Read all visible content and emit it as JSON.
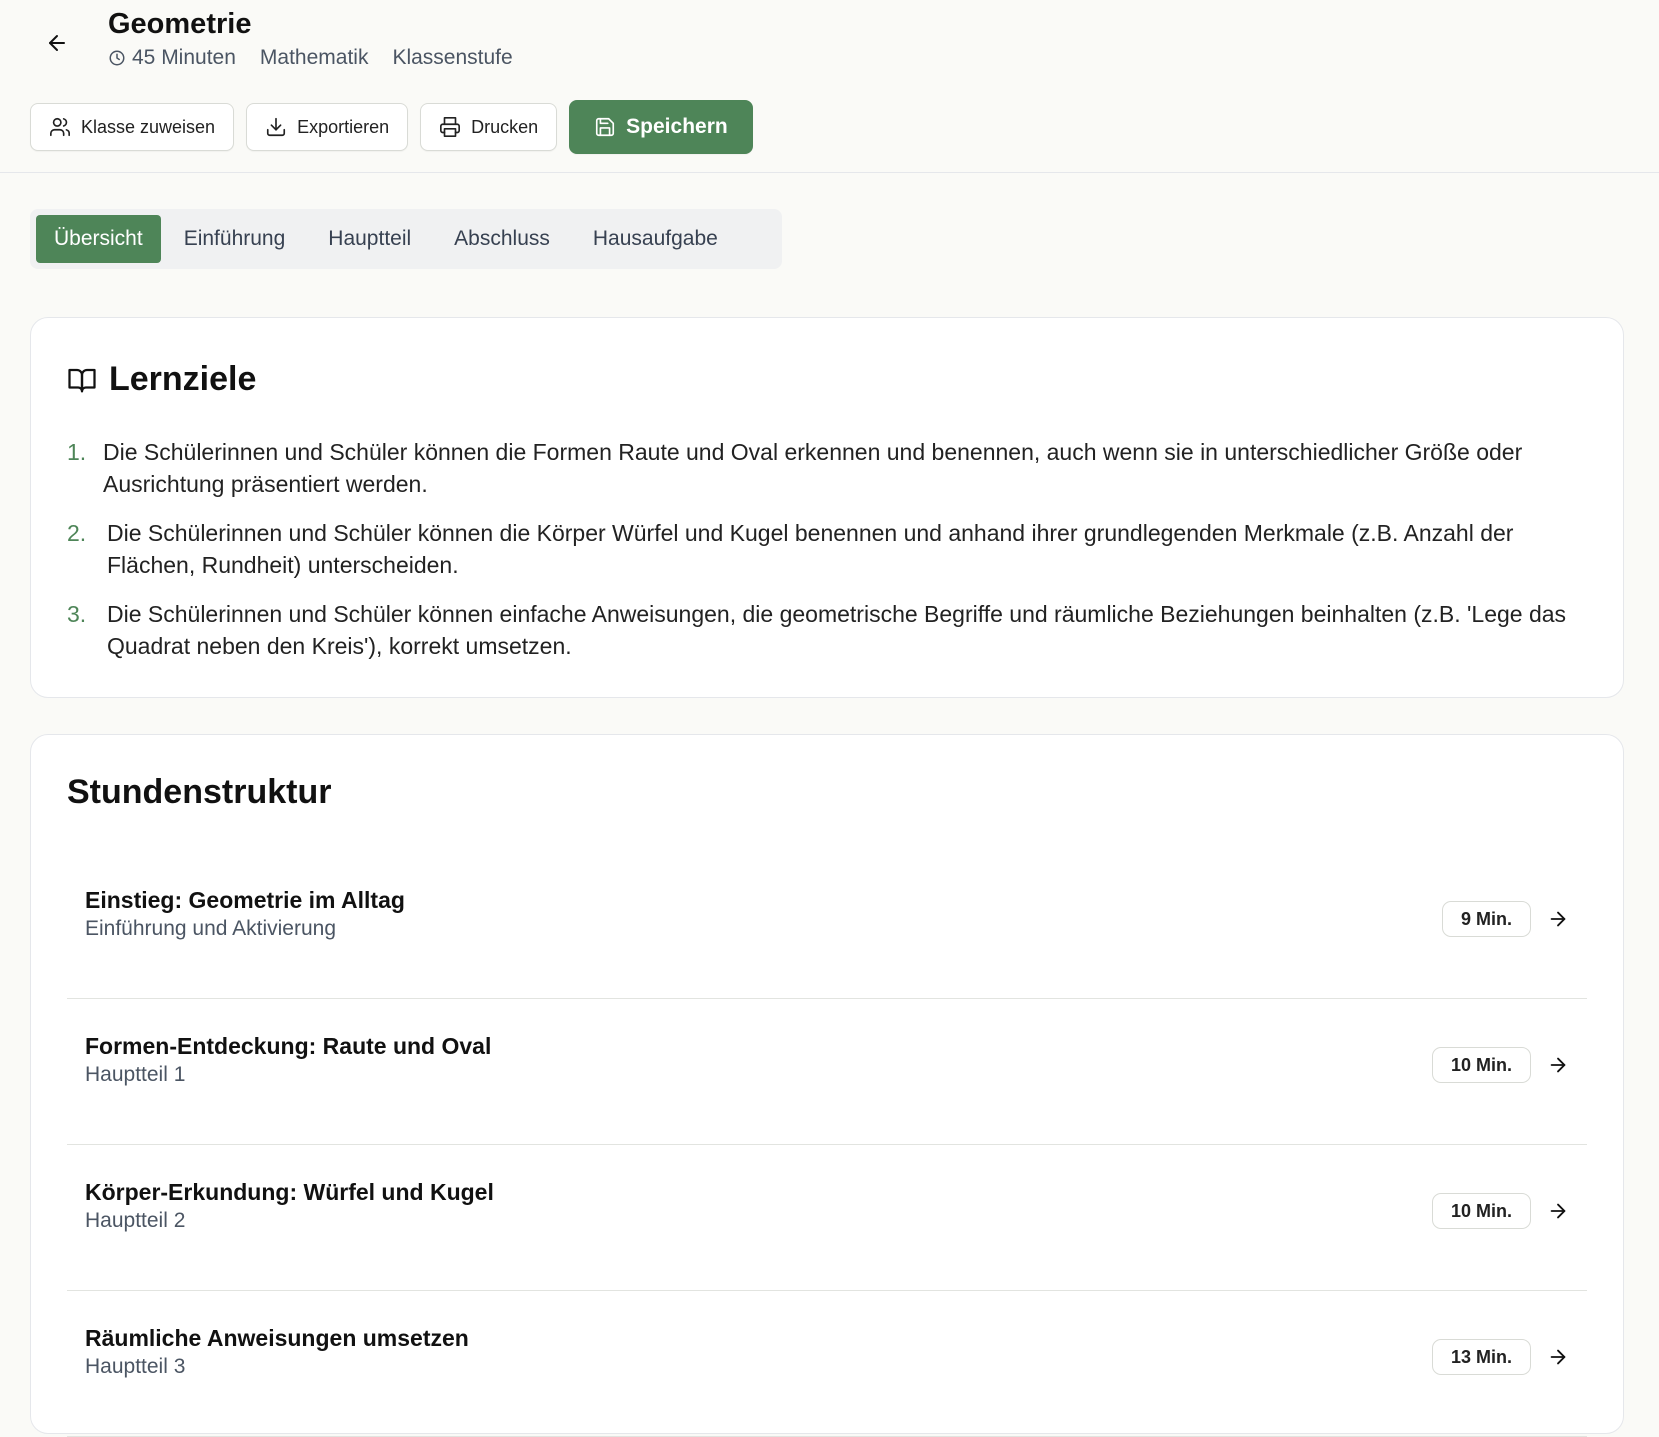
{
  "header": {
    "title": "Geometrie",
    "duration": "45 Minuten",
    "subject": "Mathematik",
    "grade": "Klassenstufe",
    "icons": {
      "back": "arrow-left-icon",
      "clock": "clock-icon"
    }
  },
  "actions": {
    "assign_label": "Klasse zuweisen",
    "export_label": "Exportieren",
    "print_label": "Drucken",
    "save_label": "Speichern"
  },
  "tabs": [
    {
      "label": "Übersicht",
      "active": true
    },
    {
      "label": "Einführung",
      "active": false
    },
    {
      "label": "Hauptteil",
      "active": false
    },
    {
      "label": "Abschluss",
      "active": false
    },
    {
      "label": "Hausaufgabe",
      "active": false
    }
  ],
  "learning_goals": {
    "title": "Lernziele",
    "items": [
      {
        "num": "1.",
        "text": "Die Schülerinnen und Schüler können die Formen Raute und Oval erkennen und benennen, auch wenn sie in unterschiedlicher Größe oder Ausrichtung präsentiert werden."
      },
      {
        "num": "2.",
        "text": "Die Schülerinnen und Schüler können die Körper Würfel und Kugel benennen und anhand ihrer grundlegenden Merkmale (z.B. Anzahl der Flächen, Rundheit) unterscheiden."
      },
      {
        "num": "3.",
        "text": "Die Schülerinnen und Schüler können einfache Anweisungen, die geometrische Begriffe und räumliche Beziehungen beinhalten (z.B. 'Lege das Quadrat neben den Kreis'), korrekt umsetzen."
      }
    ]
  },
  "structure": {
    "title": "Stundenstruktur",
    "items": [
      {
        "title": "Einstieg: Geometrie im Alltag",
        "subtitle": "Einführung und Aktivierung",
        "duration": "9 Min."
      },
      {
        "title": "Formen-Entdeckung: Raute und Oval",
        "subtitle": "Hauptteil 1",
        "duration": "10 Min."
      },
      {
        "title": "Körper-Erkundung: Würfel und Kugel",
        "subtitle": "Hauptteil 2",
        "duration": "10 Min."
      },
      {
        "title": "Räumliche Anweisungen umsetzen",
        "subtitle": "Hauptteil 3",
        "duration": "13 Min."
      }
    ]
  },
  "colors": {
    "accent": "#4e8558",
    "background": "#fafaf7",
    "card": "#ffffff",
    "border": "#e5e7eb"
  }
}
